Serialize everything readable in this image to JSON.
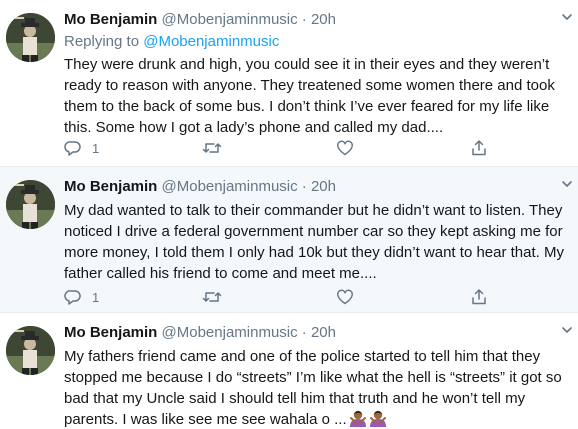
{
  "tweets": [
    {
      "name": "Mo Benjamin",
      "handle": "@Mobenjaminmusic",
      "separator": "·",
      "time": "20h",
      "replying_prefix": "Replying to ",
      "replying_mention": "@Mobenjaminmusic",
      "text": "They were drunk and high, you could see it in their eyes and they weren’t ready to reason with anyone. They treatened some women there and took them to the back of some bus. I don’t think I’ve ever feared for my life like this. Some how I got a lady’s phone and called my dad....",
      "reply_count": "1",
      "retweet_count": "",
      "like_count": ""
    },
    {
      "name": "Mo Benjamin",
      "handle": "@Mobenjaminmusic",
      "separator": "·",
      "time": "20h",
      "text": "My dad wanted to talk to their commander but he didn’t want to listen. They noticed I drive a federal government number car so they kept asking me for more money, I told them I only had 10k but they didn’t want to hear that. My father called his friend to come and meet me....",
      "reply_count": "1",
      "retweet_count": "",
      "like_count": ""
    },
    {
      "name": "Mo Benjamin",
      "handle": "@Mobenjaminmusic",
      "separator": "·",
      "time": "20h",
      "text": "My fathers friend came and one of the police started to tell him that they stopped me because I do “streets” I’m like what the hell is “streets” it got so bad that my Uncle said I should tell him that truth and he won’t tell my parents. I was like see me see wahala o ...",
      "emojis": [
        "person-gesturing-no-emoji",
        "person-gesturing-no-emoji"
      ]
    }
  ],
  "colors": {
    "text": "#14171a",
    "secondary": "#657786",
    "link": "#1da1f2",
    "highlight_bg": "#f5f8fa",
    "divider": "#e6ecf0"
  }
}
